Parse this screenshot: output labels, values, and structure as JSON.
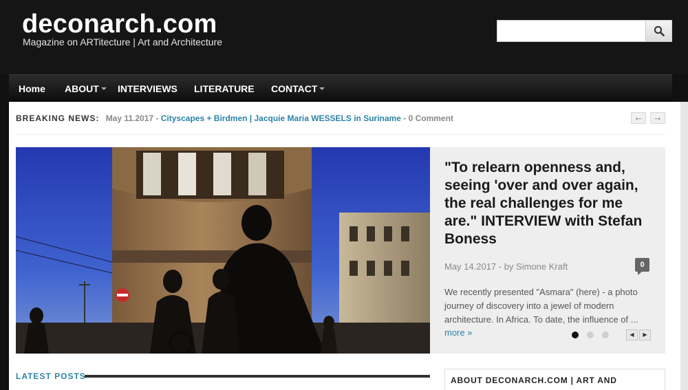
{
  "header": {
    "site_title": "deconarch.com",
    "tagline": "Magazine on ARTitecture | Art and Architecture",
    "search_placeholder": ""
  },
  "nav": {
    "items": [
      {
        "label": "Home",
        "has_dropdown": false
      },
      {
        "label": "ABOUT",
        "has_dropdown": true
      },
      {
        "label": "INTERVIEWS",
        "has_dropdown": false
      },
      {
        "label": "LITERATURE",
        "has_dropdown": false
      },
      {
        "label": "CONTACT",
        "has_dropdown": true
      }
    ]
  },
  "breaking": {
    "label": "BREAKING NEWS:",
    "date": "May 11.2017 - ",
    "link": "Cityscapes + Birdmen | Jacquie Maria WESSELS in Suriname",
    "comment": " - 0 Comment",
    "prev_icon": "←",
    "next_icon": "→"
  },
  "slider": {
    "title": "\"To relearn openness and, seeing 'over and over again, the real challenges for me are.\" INTERVIEW with Stefan Boness",
    "meta": "May 14.2017 - by Simone Kraft",
    "comment_count": "0",
    "excerpt": "We recently presented \"Asmara\" (here) - a photo journey of discovery into a jewel of modern architecture. In Africa. To date, the influence of ...",
    "more_label": "more »",
    "dots": 3,
    "active_dot": 0,
    "prev_icon": "◀",
    "next_icon": "▶"
  },
  "latest": {
    "title": "LATEST POSTS"
  },
  "sidebar": {
    "about_title": "ABOUT DECONARCH.COM | ART AND"
  },
  "colors": {
    "header_bg": "#151515",
    "accent": "#2b83a8",
    "panel_bg": "#eeeeee"
  }
}
